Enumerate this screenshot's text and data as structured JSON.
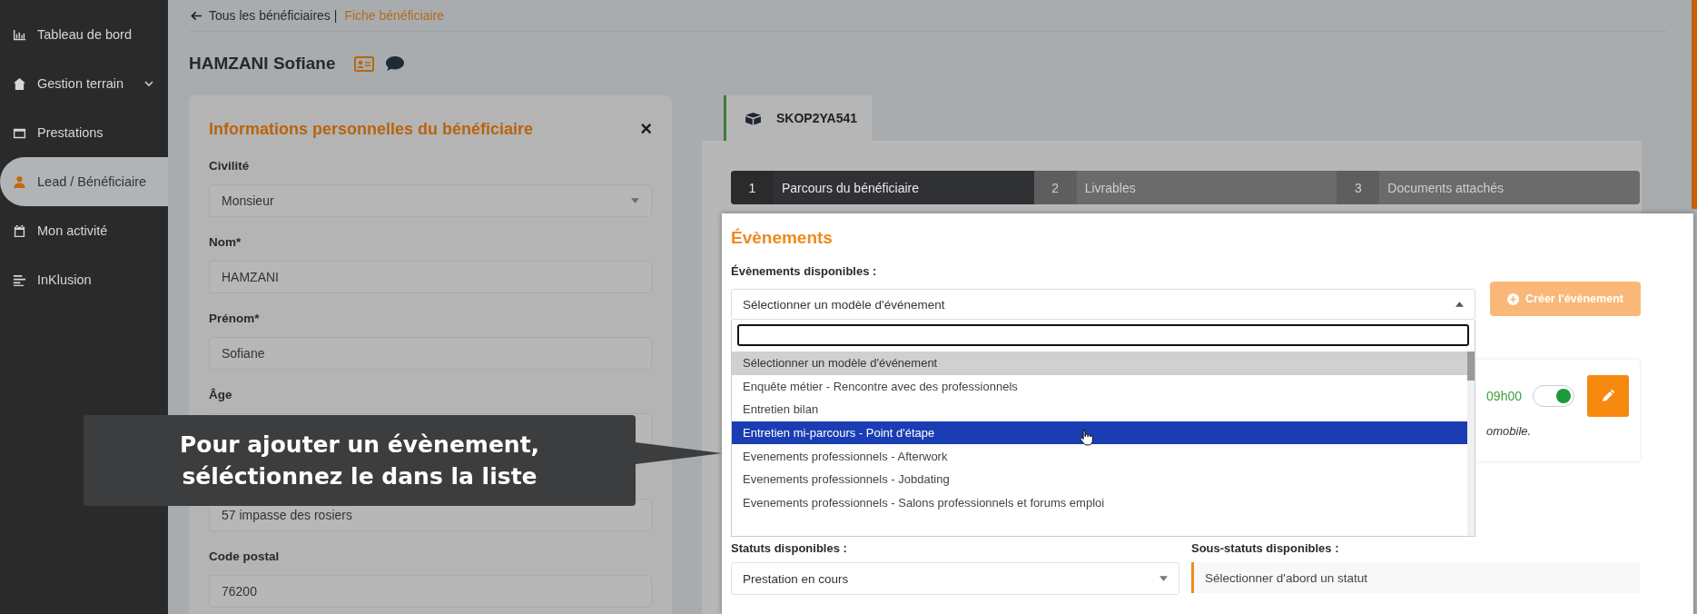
{
  "sidebar": {
    "items": [
      {
        "label": "Tableau de bord",
        "selected": false,
        "expandable": false
      },
      {
        "label": "Gestion terrain",
        "selected": false,
        "expandable": true
      },
      {
        "label": "Prestations",
        "selected": false,
        "expandable": false
      },
      {
        "label": "Lead / Bénéficiaire",
        "selected": true,
        "expandable": false
      },
      {
        "label": "Mon activité",
        "selected": false,
        "expandable": false
      },
      {
        "label": "InKlusion",
        "selected": false,
        "expandable": false
      }
    ]
  },
  "breadcrumb": {
    "back": "Tous les bénéficiaires |",
    "current": "Fiche bénéficiaire"
  },
  "person": {
    "name": "HAMZANI Sofiane"
  },
  "info_card": {
    "title": "Informations personnelles du bénéficiaire",
    "close": "×",
    "fields": [
      {
        "label": "Civilité",
        "value": "Monsieur",
        "kind": "select"
      },
      {
        "label": "Nom*",
        "value": "HAMZANI",
        "kind": "text"
      },
      {
        "label": "Prénom*",
        "value": "Sofiane",
        "kind": "text"
      },
      {
        "label": "Âge",
        "kind": "select"
      },
      {
        "value": "57 impasse des rosiers",
        "kind": "text"
      },
      {
        "label": "Code postal",
        "value": "76200",
        "kind": "text"
      }
    ]
  },
  "record_tab": {
    "label": "SKOP2YA541"
  },
  "steps": [
    {
      "number": "1",
      "label": "Parcours du bénéficiaire",
      "selected": true
    },
    {
      "number": "2",
      "label": "Livrables",
      "selected": false
    },
    {
      "number": "3",
      "label": "Documents attachés",
      "selected": false
    }
  ],
  "events": {
    "title": "Évènements",
    "available_label": "Évènements disponibles :",
    "select": {
      "value": "Sélectionner un modèle d'événement",
      "expanded": true
    },
    "create_button": "Créer l'évènement",
    "create_disabled": true,
    "options": [
      {
        "label": "Sélectionner un modèle d'événement",
        "selected": true,
        "highlighted": false
      },
      {
        "label": "Enquête métier - Rencontre avec des professionnels",
        "selected": false,
        "highlighted": false
      },
      {
        "label": "Entretien bilan",
        "selected": false,
        "highlighted": false
      },
      {
        "label": "Entretien mi-parcours - Point d'étape",
        "selected": false,
        "highlighted": true
      },
      {
        "label": "Evenements professionnels - Afterwork",
        "selected": false,
        "highlighted": false
      },
      {
        "label": "Evenements professionnels - Jobdating",
        "selected": false,
        "highlighted": false
      },
      {
        "label": "Evenements professionnels - Salons professionnels et forums emploi",
        "selected": false,
        "highlighted": false
      }
    ]
  },
  "event_card": {
    "time": "09h00",
    "note": "omobile.",
    "on": true
  },
  "statuts": {
    "label": "Statuts disponibles :",
    "value": "Prestation en cours"
  },
  "sous_statuts": {
    "label": "Sous-statuts disponibles :",
    "text": "Sélectionner d'abord un statut"
  },
  "tooltip": {
    "lines": [
      "Pour ajouter un évènement,",
      "séléctionnez le dans la liste"
    ]
  }
}
